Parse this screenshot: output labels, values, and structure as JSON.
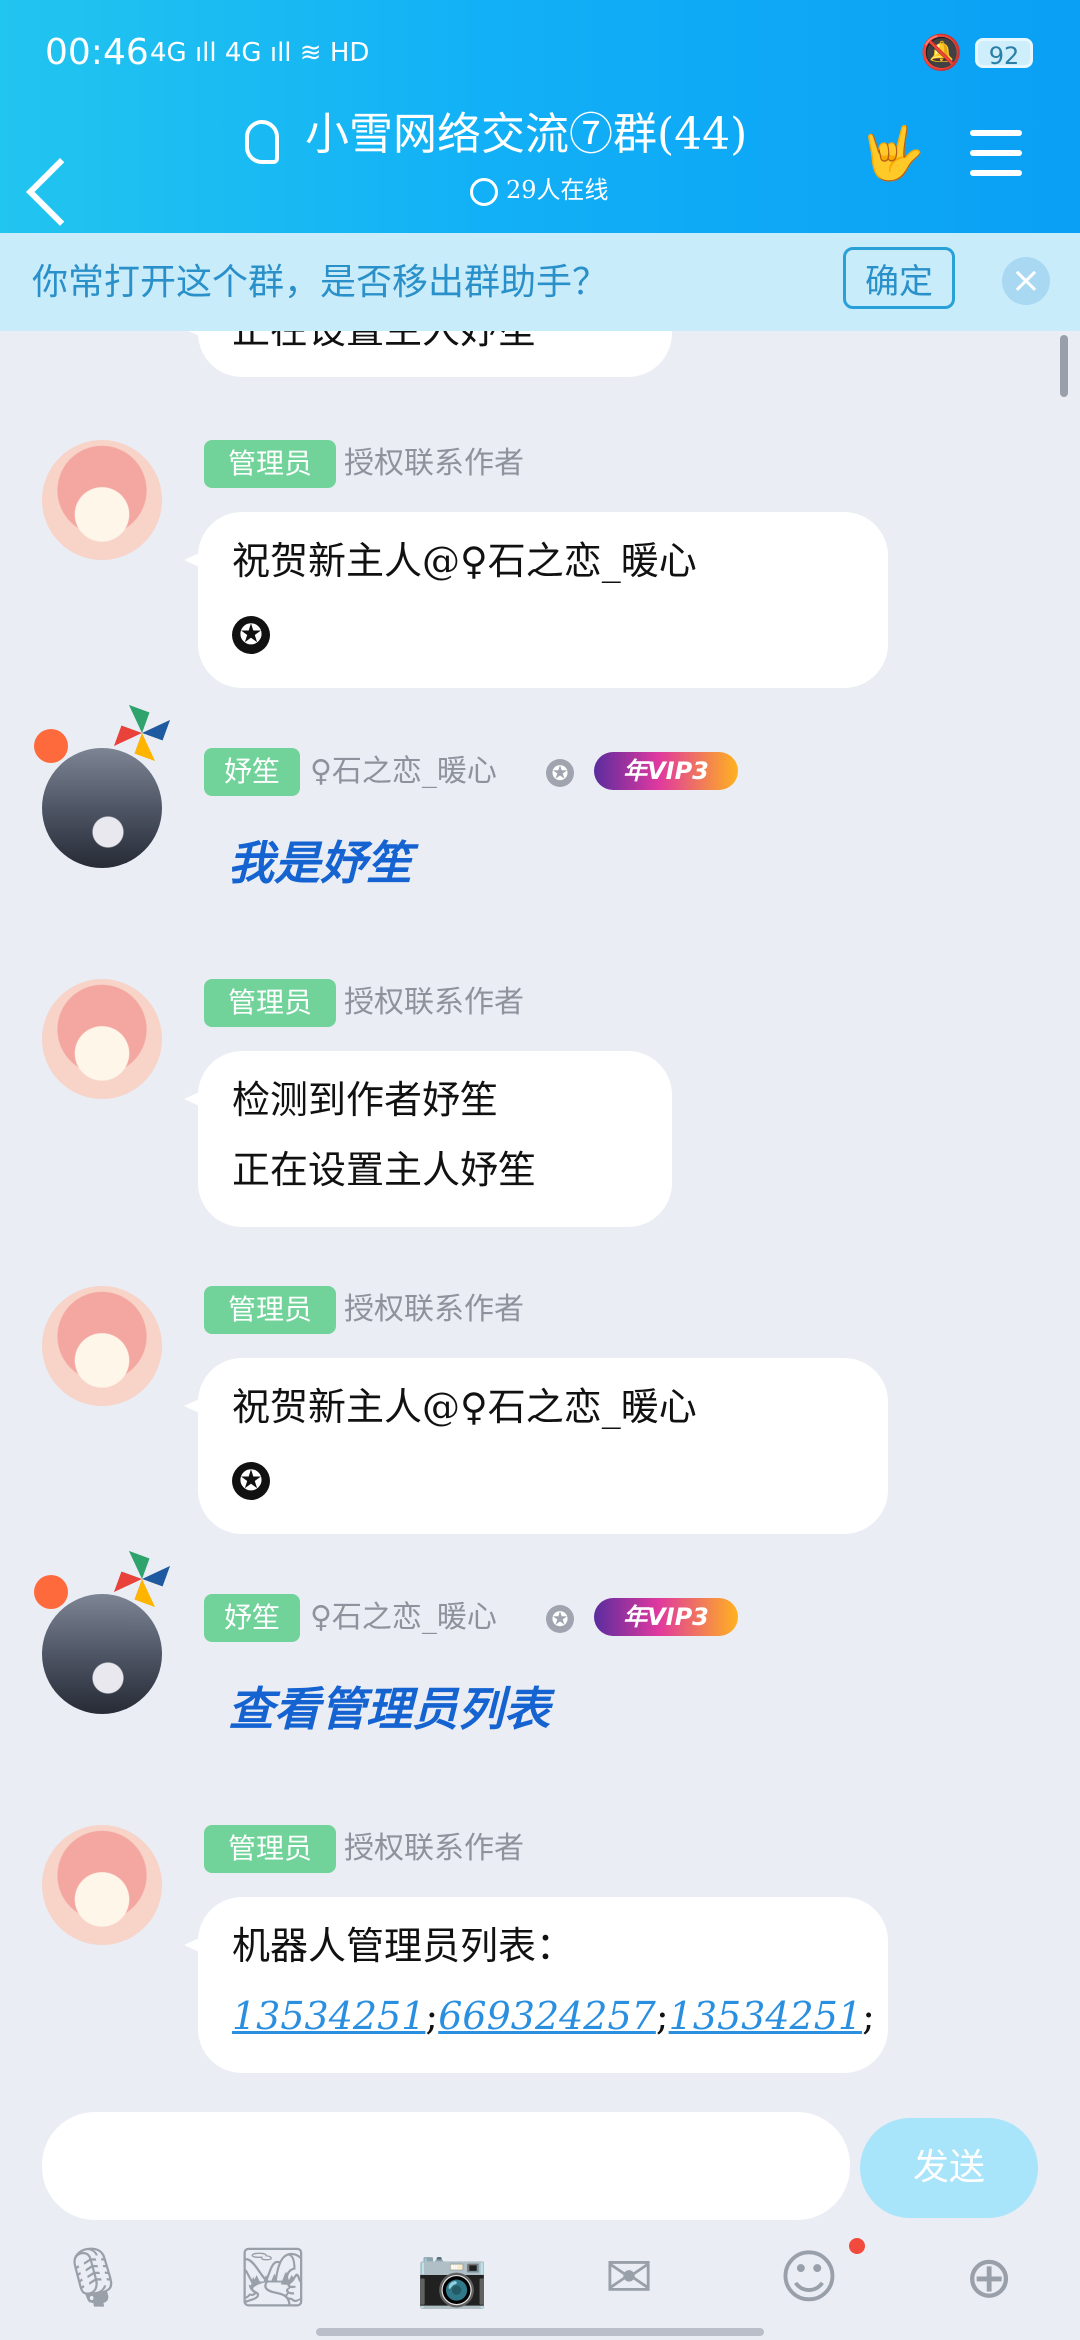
{
  "status_bar": {
    "time": "00:46",
    "network": "4G ıll 4G ıll ≋ HD",
    "silent_icon": "🔕",
    "battery": "92"
  },
  "header": {
    "title": "小雪网络交流⑦群(44)",
    "online": "29人在线",
    "hand_icon": "🤟"
  },
  "notice": {
    "text": "你常打开这个群，是否移出群助手？",
    "confirm": "确定",
    "close": "×"
  },
  "partial_bubble": "正在设置主人妤笙",
  "messages": [
    {
      "type": "admin",
      "badge": "管理员",
      "sender": "授权联系作者",
      "lines": [
        "祝贺新主人@♀石之恋_暖心"
      ],
      "star": "✪"
    },
    {
      "type": "user",
      "badge": "妤笙",
      "sender": "♀石之恋_暖心",
      "level": "✪",
      "vip": "年VIP3",
      "text": "我是妤笙"
    },
    {
      "type": "admin",
      "badge": "管理员",
      "sender": "授权联系作者",
      "lines": [
        "检测到作者妤笙",
        "正在设置主人妤笙"
      ]
    },
    {
      "type": "admin",
      "badge": "管理员",
      "sender": "授权联系作者",
      "lines": [
        "祝贺新主人@♀石之恋_暖心"
      ],
      "star": "✪"
    },
    {
      "type": "user",
      "badge": "妤笙",
      "sender": "♀石之恋_暖心",
      "level": "✪",
      "vip": "年VIP3",
      "text": "查看管理员列表"
    },
    {
      "type": "admin",
      "badge": "管理员",
      "sender": "授权联系作者",
      "lines": [
        "机器人管理员列表："
      ],
      "links": [
        "13534251",
        "669324257",
        "13534251"
      ]
    }
  ],
  "input": {
    "placeholder": "",
    "send": "发送"
  },
  "toolbar": {
    "mic": "🎙",
    "image": "🏞",
    "camera": "📷",
    "redpacket": "✉",
    "emoji": "☺",
    "plus": "⊕"
  }
}
